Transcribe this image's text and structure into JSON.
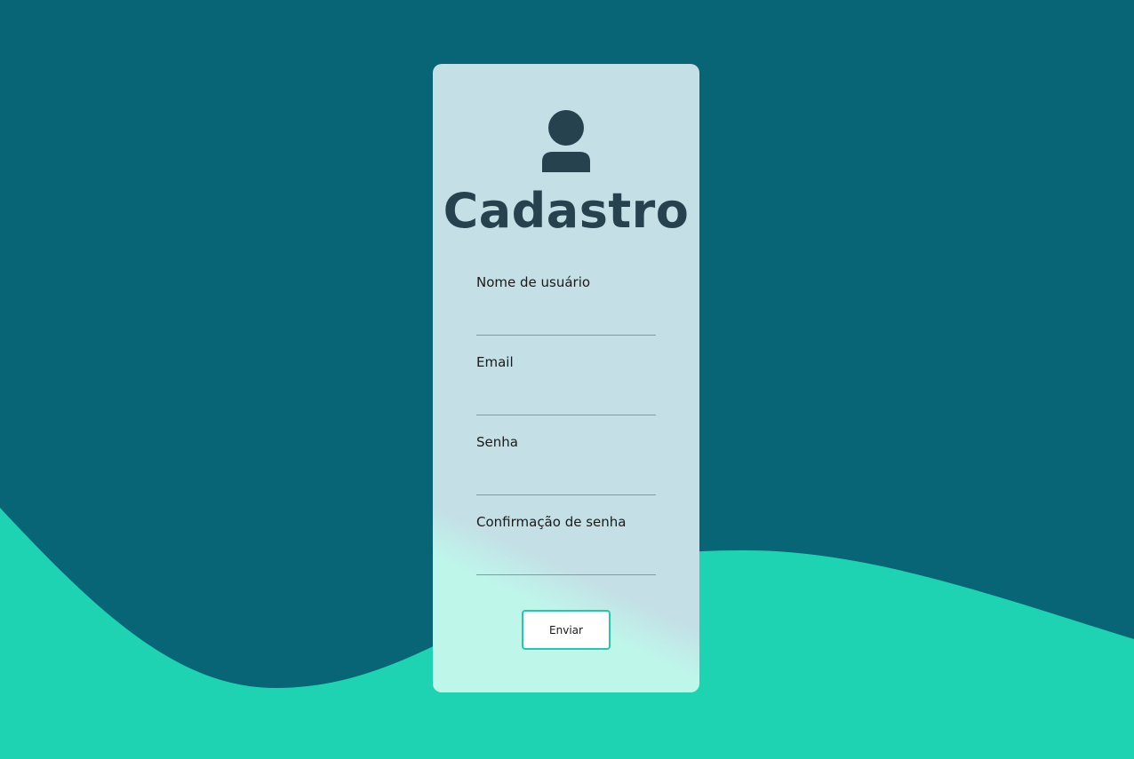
{
  "colors": {
    "background_dark": "#086575",
    "wave": "#1ed3b2",
    "card": "#c4dfe6",
    "card_bottom": "#bef6ea",
    "title": "#26424f",
    "accent": "#26c7b0"
  },
  "header": {
    "icon": "user-icon",
    "title": "Cadastro"
  },
  "form": {
    "username": {
      "label": "Nome de usuário",
      "value": ""
    },
    "email": {
      "label": "Email",
      "value": ""
    },
    "password": {
      "label": "Senha",
      "value": ""
    },
    "password_confirm": {
      "label": "Confirmação de senha",
      "value": ""
    },
    "submit_label": "Enviar"
  }
}
